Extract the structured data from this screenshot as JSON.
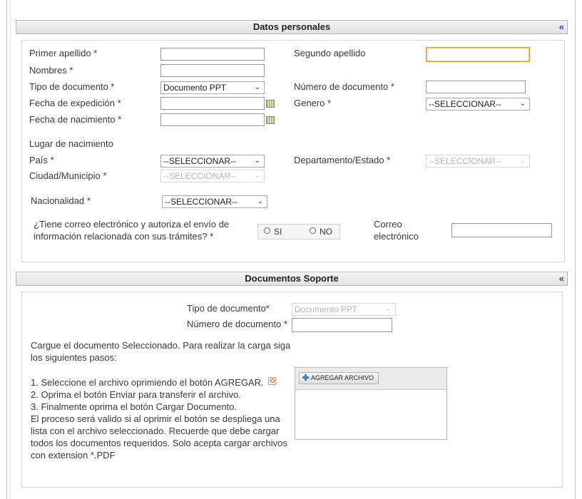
{
  "personal": {
    "title": "Datos personales",
    "collapse": "«",
    "primer_apellido": "Primer apellido *",
    "segundo_apellido": "Segundo apellido",
    "nombres": "Nombres *",
    "tipo_documento": "Tipo de documento *",
    "tipo_documento_value": "Documento PPT",
    "numero_documento": "Número de documento *",
    "fecha_expedicion": "Fecha de expedición *",
    "genero": "Genero *",
    "genero_value": "--SELECCIONAR--",
    "fecha_nacimiento": "Fecha de nacimiento *",
    "lugar_nacimiento": "Lugar de nacimiento",
    "pais": "País *",
    "pais_value": "--SELECCIONAR--",
    "departamento": "Departamento/Estado *",
    "departamento_value": "--SELECCIONAR--",
    "ciudad": "Ciudad/Municipio *",
    "ciudad_value": "--SELECCIONAR--",
    "nacionalidad": "Nacionalidad *",
    "nacionalidad_value": "--SELECCIONAR--",
    "correo_pregunta_1": "¿Tiene correo electrónico y autoriza el envío de",
    "correo_pregunta_2": "información relacionada con sus trámites? *",
    "si": "SI",
    "no": "NO",
    "correo_label_1": "Correo",
    "correo_label_2": "electrónico"
  },
  "soporte": {
    "title": "Documentos Soporte",
    "collapse": "«",
    "tipo_documento": "Tipo de documento*",
    "tipo_documento_value": "Documento PPT",
    "numero_documento": "Número de documento *",
    "instruccion_1": "Cargue el documento Seleccionado. Para realizar la carga siga",
    "instruccion_2": "los siguientes pasos:",
    "paso_1": "1. Seleccione el archivo oprimiendo el botón AGREGAR.",
    "paso_2": "2. Oprima el botón Enviar para transferir el archivo.",
    "paso_3": "3. Finalmente oprima el botón Cargar Documento.",
    "nota_1": "El proceso será valido si al oprimir el botón se despliega una",
    "nota_2": "lista con el archivo seleccionado. Recuerde que debe cargar",
    "nota_3": "todos los documentos requeridos. Solo acepta cargar archivos",
    "nota_4": "con extension *.PDF",
    "agregar_archivo": "AGREGAR ARCHIVO"
  },
  "icons": {
    "chevron": "chevron-down-icon",
    "calendar": "calendar-icon",
    "plus": "plus-icon",
    "search": "search-icon"
  },
  "colors": {
    "focus_border": "#e0a12c",
    "collapse_link": "#1f4f8f",
    "plus_icon": "#3d7fc6"
  }
}
